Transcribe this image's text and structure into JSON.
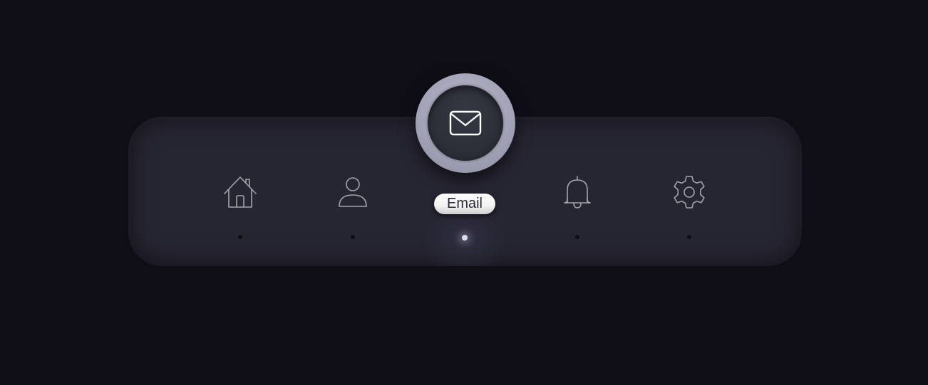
{
  "nav": {
    "active_index": 2,
    "items": [
      {
        "id": "home",
        "icon": "home-icon"
      },
      {
        "id": "profile",
        "icon": "user-icon"
      },
      {
        "id": "email",
        "icon": "mail-icon"
      },
      {
        "id": "notifications",
        "icon": "bell-icon"
      },
      {
        "id": "settings",
        "icon": "gear-icon"
      }
    ],
    "active_tooltip": "Email"
  },
  "colors": {
    "background": "#0f0e16",
    "bar": "#262532",
    "icon": "#a3a3ab",
    "active_ring": "#a8a8bc",
    "active_inner": "#2e323a",
    "tooltip_bg": "#ffffff",
    "tooltip_text": "#2b2b33"
  }
}
